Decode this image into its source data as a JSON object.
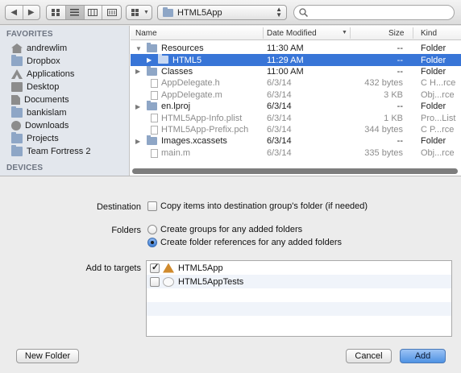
{
  "toolbar": {
    "nav_back": "◀",
    "nav_forward": "▶",
    "view_buttons": [
      "icon-view",
      "list-view",
      "column-view",
      "coverflow-view"
    ],
    "arrange_icon": "arrange-icon",
    "location": "HTML5App",
    "search_placeholder": ""
  },
  "sidebar": {
    "favorites_header": "FAVORITES",
    "favorites": [
      {
        "label": "andrewlim",
        "icon": "home-icon"
      },
      {
        "label": "Dropbox",
        "icon": "folder-icon"
      },
      {
        "label": "Applications",
        "icon": "applications-icon"
      },
      {
        "label": "Desktop",
        "icon": "desktop-icon"
      },
      {
        "label": "Documents",
        "icon": "documents-icon"
      },
      {
        "label": "bankislam",
        "icon": "folder-icon"
      },
      {
        "label": "Downloads",
        "icon": "downloads-icon"
      },
      {
        "label": "Projects",
        "icon": "folder-icon"
      },
      {
        "label": "Team Fortress 2",
        "icon": "folder-icon"
      }
    ],
    "devices_header": "DEVICES"
  },
  "filelist": {
    "columns": {
      "name": "Name",
      "date": "Date Modified",
      "size": "Size",
      "kind": "Kind"
    },
    "rows": [
      {
        "name": "Resources",
        "date": "11:30 AM",
        "size": "--",
        "kind": "Folder",
        "type": "folder",
        "tri": "▼",
        "selected": false,
        "dim": false
      },
      {
        "name": "HTML5",
        "date": "11:29 AM",
        "size": "--",
        "kind": "Folder",
        "type": "folder",
        "tri": "▶",
        "selected": true,
        "dim": false
      },
      {
        "name": "Classes",
        "date": "11:00 AM",
        "size": "--",
        "kind": "Folder",
        "type": "folder",
        "tri": "▶",
        "selected": false,
        "dim": false
      },
      {
        "name": "AppDelegate.h",
        "date": "6/3/14",
        "size": "432 bytes",
        "kind": "C H...rce",
        "type": "file",
        "tri": "",
        "selected": false,
        "dim": true
      },
      {
        "name": "AppDelegate.m",
        "date": "6/3/14",
        "size": "3 KB",
        "kind": "Obj...rce",
        "type": "file",
        "tri": "",
        "selected": false,
        "dim": true
      },
      {
        "name": "en.lproj",
        "date": "6/3/14",
        "size": "--",
        "kind": "Folder",
        "type": "folder",
        "tri": "▶",
        "selected": false,
        "dim": false
      },
      {
        "name": "HTML5App-Info.plist",
        "date": "6/3/14",
        "size": "1 KB",
        "kind": "Pro...List",
        "type": "file",
        "tri": "",
        "selected": false,
        "dim": true
      },
      {
        "name": "HTML5App-Prefix.pch",
        "date": "6/3/14",
        "size": "344 bytes",
        "kind": "C P...rce",
        "type": "file",
        "tri": "",
        "selected": false,
        "dim": true
      },
      {
        "name": "Images.xcassets",
        "date": "6/3/14",
        "size": "--",
        "kind": "Folder",
        "type": "folder",
        "tri": "▶",
        "selected": false,
        "dim": false
      },
      {
        "name": "main.m",
        "date": "6/3/14",
        "size": "335 bytes",
        "kind": "Obj...rce",
        "type": "file",
        "tri": "",
        "selected": false,
        "dim": true
      }
    ]
  },
  "options": {
    "destination_label": "Destination",
    "destination_option": "Copy items into destination group's folder (if needed)",
    "folders_label": "Folders",
    "folders_option_groups": "Create groups for any added folders",
    "folders_option_refs": "Create folder references for any added folders",
    "targets_label": "Add to targets",
    "targets": [
      {
        "name": "HTML5App",
        "checked": true
      },
      {
        "name": "HTML5AppTests",
        "checked": false
      }
    ]
  },
  "buttons": {
    "new_folder": "New Folder",
    "cancel": "Cancel",
    "add": "Add"
  },
  "colors": {
    "selection": "#3875d7",
    "sidebar_bg": "#e3e7ed"
  }
}
